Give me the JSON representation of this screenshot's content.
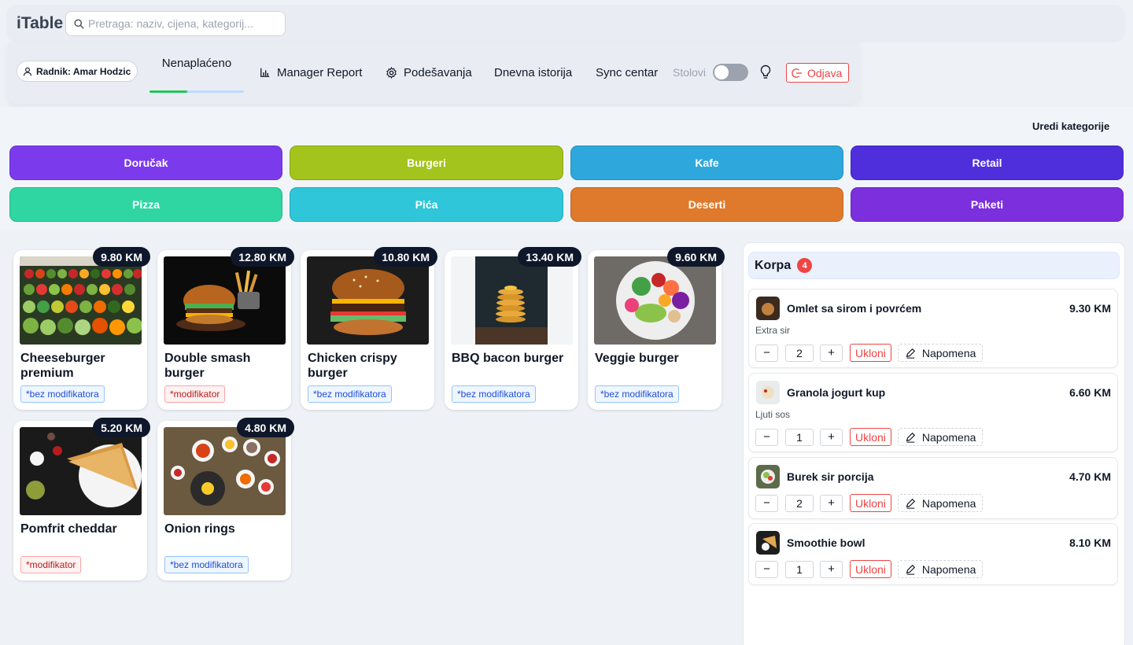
{
  "app": {
    "title": "iTable"
  },
  "search": {
    "placeholder": "Pretraga: naziv, cijena, kategorij..."
  },
  "nav": {
    "worker_label": "Radnik: Amar Hodzic",
    "unpaid_label": "Nenaplaćeno",
    "unpaid_progress": 0.4,
    "manager_report_label": "Manager Report",
    "settings_label": "Podešavanja",
    "daily_history_label": "Dnevna istorija",
    "sync_label": "Sync centar",
    "tables_label": "Stolovi",
    "tables_toggle_on": false,
    "logout_label": "Odjava"
  },
  "categories": {
    "edit_label": "Uredi kategorije",
    "items": [
      {
        "label": "Doručak",
        "color": "#7c3aed"
      },
      {
        "label": "Burgeri",
        "color": "#a3c41c"
      },
      {
        "label": "Kafe",
        "color": "#2ea8dc"
      },
      {
        "label": "Retail",
        "color": "#4f2fdc"
      },
      {
        "label": "Pizza",
        "color": "#2fd6a2"
      },
      {
        "label": "Pića",
        "color": "#2fc6d9"
      },
      {
        "label": "Deserti",
        "color": "#df7a2c"
      },
      {
        "label": "Paketi",
        "color": "#7c2fdc"
      }
    ]
  },
  "products": [
    {
      "name": "Cheeseburger premium",
      "price": "9.80 KM",
      "tag": "*bez modifikatora",
      "tag_type": "blue",
      "image": "vegetables-image"
    },
    {
      "name": "Double smash burger",
      "price": "12.80 KM",
      "tag": "*modifikator",
      "tag_type": "red",
      "image": "burger-fries-image"
    },
    {
      "name": "Chicken crispy burger",
      "price": "10.80 KM",
      "tag": "*bez modifikatora",
      "tag_type": "blue",
      "image": "cheeseburger-image"
    },
    {
      "name": "BBQ bacon burger",
      "price": "13.40 KM",
      "tag": "*bez modifikatora",
      "tag_type": "blue",
      "image": "pancakes-image"
    },
    {
      "name": "Veggie burger",
      "price": "9.60 KM",
      "tag": "*bez modifikatora",
      "tag_type": "blue",
      "image": "salad-bowl-image"
    },
    {
      "name": "Pomfrit cheddar",
      "price": "5.20 KM",
      "tag": "*modifikator",
      "tag_type": "red",
      "image": "sandwich-image"
    },
    {
      "name": "Onion rings",
      "price": "4.80 KM",
      "tag": "*bez modifikatora",
      "tag_type": "blue",
      "image": "food-table-image"
    }
  ],
  "cart": {
    "title": "Korpa",
    "count": "4",
    "remove_label": "Ukloni",
    "note_label": "Napomena",
    "items": [
      {
        "name": "Omlet sa sirom i povrćem",
        "price": "9.30 KM",
        "modifier": "Extra sir",
        "qty": "2"
      },
      {
        "name": "Granola jogurt kup",
        "price": "6.60 KM",
        "modifier": "Ljuti sos",
        "qty": "1"
      },
      {
        "name": "Burek sir porcija",
        "price": "4.70 KM",
        "modifier": "",
        "qty": "2"
      },
      {
        "name": "Smoothie bowl",
        "price": "8.10 KM",
        "modifier": "",
        "qty": "1"
      }
    ]
  }
}
